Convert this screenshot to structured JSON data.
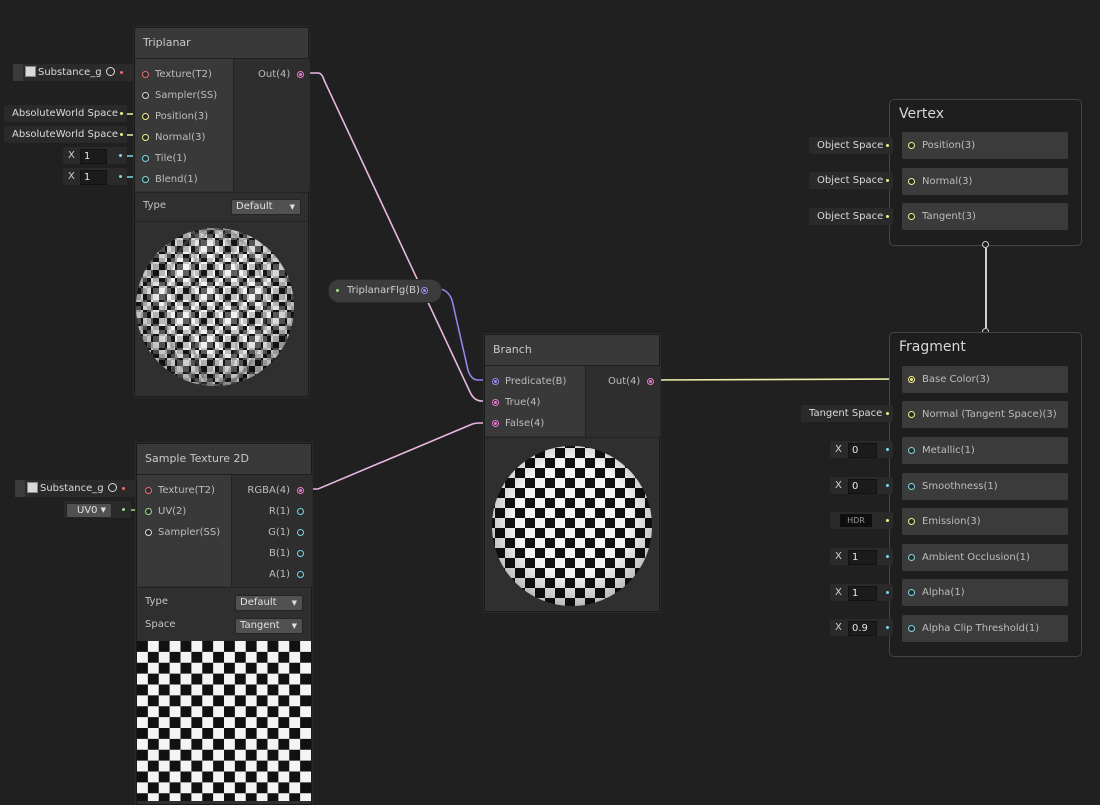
{
  "nodes": {
    "triplanar": {
      "title": "Triplanar",
      "inputs": [
        "Texture(T2)",
        "Sampler(SS)",
        "Position(3)",
        "Normal(3)",
        "Tile(1)",
        "Blend(1)"
      ],
      "output": "Out(4)",
      "type_label": "Type",
      "type_value": "Default"
    },
    "sample_texture": {
      "title": "Sample Texture 2D",
      "inputs": [
        "Texture(T2)",
        "UV(2)",
        "Sampler(SS)"
      ],
      "outputs": [
        "RGBA(4)",
        "R(1)",
        "G(1)",
        "B(1)",
        "A(1)"
      ],
      "type_label": "Type",
      "type_value": "Default",
      "space_label": "Space",
      "space_value": "Tangent"
    },
    "branch": {
      "title": "Branch",
      "inputs": [
        "Predicate(B)",
        "True(4)",
        "False(4)"
      ],
      "output": "Out(4)"
    },
    "property": {
      "label": "TriplanarFlg(B)"
    }
  },
  "inline_inputs": {
    "triplanar_texture": "Substance_g",
    "triplanar_position": "AbsoluteWorld Space",
    "triplanar_normal": "AbsoluteWorld Space",
    "triplanar_tile_axis": "X",
    "triplanar_tile": "1",
    "triplanar_blend_axis": "X",
    "triplanar_blend": "1",
    "sample_texture": "Substance_g",
    "sample_uv": "UV0"
  },
  "vertex": {
    "title": "Vertex",
    "slots": [
      {
        "label": "Position(3)",
        "inline": "Object Space"
      },
      {
        "label": "Normal(3)",
        "inline": "Object Space"
      },
      {
        "label": "Tangent(3)",
        "inline": "Object Space"
      }
    ]
  },
  "fragment": {
    "title": "Fragment",
    "slots": [
      {
        "label": "Base Color(3)",
        "inline": ""
      },
      {
        "label": "Normal (Tangent Space)(3)",
        "inline": "Tangent Space"
      },
      {
        "label": "Metallic(1)",
        "axis": "X",
        "value": "0"
      },
      {
        "label": "Smoothness(1)",
        "axis": "X",
        "value": "0"
      },
      {
        "label": "Emission(3)",
        "inline": "HDR"
      },
      {
        "label": "Ambient Occlusion(1)",
        "axis": "X",
        "value": "1"
      },
      {
        "label": "Alpha(1)",
        "axis": "X",
        "value": "1"
      },
      {
        "label": "Alpha Clip Threshold(1)",
        "axis": "X",
        "value": "0.9"
      }
    ]
  },
  "colors": {
    "background": "#202020",
    "vector4_wire": "#e9b6e0",
    "vector3_wire": "#eef0a8",
    "boolean_wire": "#8f86e8",
    "texture_port": "#ee6a6a",
    "float_port": "#7ed8e6",
    "vector2_port": "#9de07a"
  }
}
